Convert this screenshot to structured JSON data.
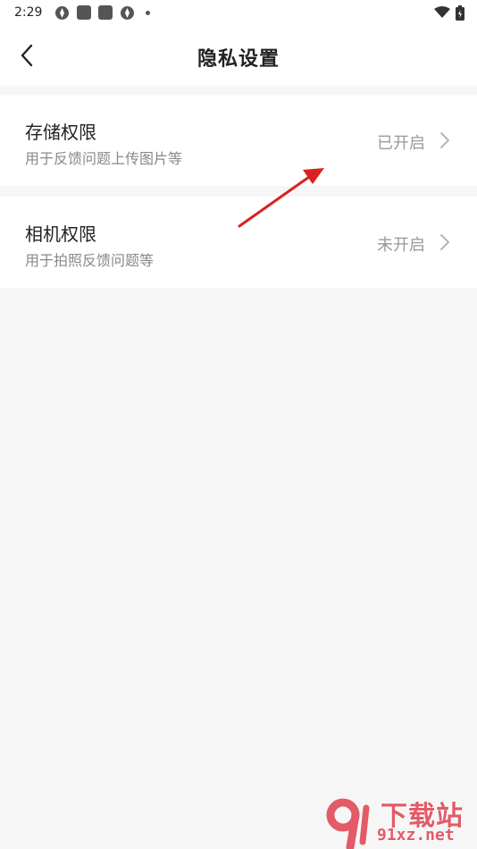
{
  "status_bar": {
    "time": "2:29"
  },
  "header": {
    "title": "隐私设置"
  },
  "items": [
    {
      "title": "存储权限",
      "subtitle": "用于反馈问题上传图片等",
      "status": "已开启"
    },
    {
      "title": "相机权限",
      "subtitle": "用于拍照反馈问题等",
      "status": "未开启"
    }
  ],
  "watermark": {
    "brand": "下载站",
    "domain": "91xz.net"
  },
  "colors": {
    "background": "#f6f6f6",
    "card": "#ffffff",
    "annotation_arrow": "#d9221f",
    "watermark": "#e25b67"
  }
}
